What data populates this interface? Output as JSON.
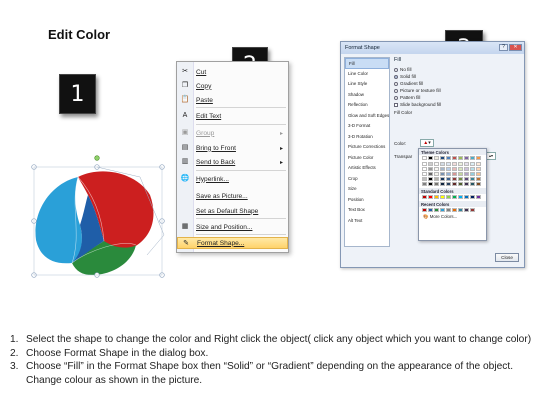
{
  "title": "Edit Color",
  "badges": [
    "1",
    "2",
    "3"
  ],
  "context_menu": {
    "items": [
      {
        "label": "Cut",
        "icon": "scissors-icon",
        "glyph": "✂",
        "disabled": false,
        "submenu": false
      },
      {
        "label": "Copy",
        "icon": "copy-icon",
        "glyph": "❐",
        "disabled": false,
        "submenu": false
      },
      {
        "label": "Paste",
        "icon": "paste-icon",
        "glyph": "📋",
        "disabled": false,
        "submenu": false
      },
      {
        "label": "Edit Text",
        "icon": "edit-text-icon",
        "glyph": "A",
        "disabled": false,
        "submenu": false
      },
      {
        "label": "Group",
        "icon": "group-icon",
        "glyph": "▣",
        "disabled": true,
        "submenu": true
      },
      {
        "label": "Bring to Front",
        "icon": "bring-to-front-icon",
        "glyph": "▤",
        "disabled": false,
        "submenu": true
      },
      {
        "label": "Send to Back",
        "icon": "send-to-back-icon",
        "glyph": "▥",
        "disabled": false,
        "submenu": true
      },
      {
        "label": "Hyperlink...",
        "icon": "hyperlink-icon",
        "glyph": "🌐",
        "disabled": false,
        "submenu": false
      },
      {
        "label": "Save as Picture...",
        "icon": "",
        "glyph": "",
        "disabled": false,
        "submenu": false
      },
      {
        "label": "Set as Default Shape",
        "icon": "",
        "glyph": "",
        "disabled": false,
        "submenu": false
      },
      {
        "label": "Size and Position...",
        "icon": "size-position-icon",
        "glyph": "▦",
        "disabled": false,
        "submenu": false
      },
      {
        "label": "Format Shape...",
        "icon": "format-shape-icon",
        "glyph": "✎",
        "disabled": false,
        "submenu": false,
        "highlighted": true
      }
    ]
  },
  "dialog": {
    "title": "Format Shape",
    "nav": [
      "Fill",
      "Line Color",
      "Line Style",
      "Shadow",
      "Reflection",
      "Glow and Soft Edges",
      "3-D Format",
      "3-D Rotation",
      "Picture Corrections",
      "Picture Color",
      "Artistic Effects",
      "Crop",
      "Size",
      "Position",
      "Text Box",
      "Alt Text"
    ],
    "pane_title": "Fill",
    "options": [
      "No fill",
      "Solid fill",
      "Gradient fill",
      "Picture or texture fill",
      "Pattern fill",
      "Slide background fill"
    ],
    "fill_color_label": "Fill Color",
    "color_label": "Color:",
    "transparency_label": "Transpar",
    "close_label": "Close"
  },
  "palette": {
    "theme_label": "Theme Colors",
    "standard_label": "Standard Colors",
    "recent_label": "Recent Colors",
    "more_label": "More Colors...",
    "theme_top": [
      "#ffffff",
      "#000000",
      "#eeece1",
      "#1f497d",
      "#4f81bd",
      "#c0504d",
      "#9bbb59",
      "#8064a2",
      "#4bacc6",
      "#f79646"
    ],
    "standard": [
      "#c00000",
      "#ff0000",
      "#ffc000",
      "#ffff00",
      "#92d050",
      "#00b050",
      "#00b0f0",
      "#0070c0",
      "#002060",
      "#7030a0"
    ],
    "recent": [
      "#c00000",
      "#1f5ea8",
      "#2a8a3c",
      "#2aa0d8",
      "#7f7f7f",
      "#e36c09",
      "#31859c",
      "#403152",
      "#953735"
    ]
  },
  "shape_colors": {
    "red": "#cc1f1f",
    "blue": "#1f5ea8",
    "green": "#2a8a3c",
    "cyan": "#2aa0d8"
  },
  "steps": [
    {
      "num": "1.",
      "text": "Select the shape to change the color and Right click the object( click any object which you want to change color)"
    },
    {
      "num": "2.",
      "text": "Choose Format Shape in the dialog box."
    },
    {
      "num": "3.",
      "text": "Choose “Fill” in the Format Shape box then “Solid” or “Gradient” depending on the appearance of the object. Change colour as shown in the picture."
    }
  ]
}
